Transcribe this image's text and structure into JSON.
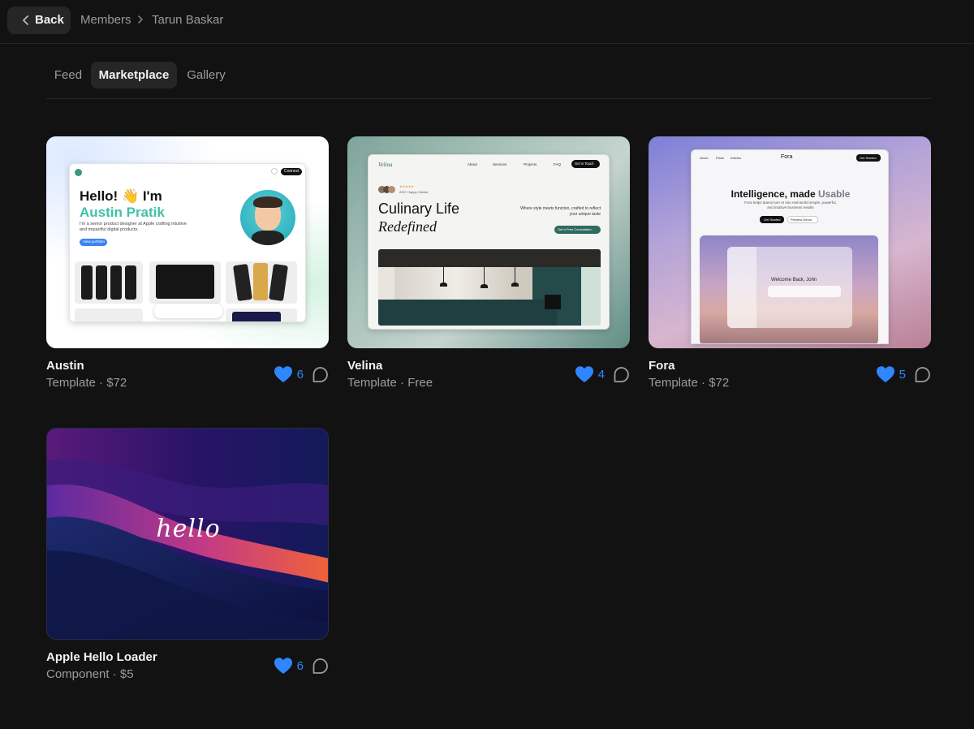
{
  "header": {
    "back_label": "Back",
    "breadcrumb": [
      "Members",
      "Tarun Baskar"
    ]
  },
  "tabs": [
    {
      "label": "Feed",
      "active": false
    },
    {
      "label": "Marketplace",
      "active": true
    },
    {
      "label": "Gallery",
      "active": false
    }
  ],
  "cards": [
    {
      "title": "Austin",
      "subtitle": "Template · $72",
      "likes": "6",
      "preview": {
        "connect": "Connect",
        "hero_line1": "Hello! 👋 I'm",
        "hero_name": "Austin Pratik",
        "bio": "I'm a senior product designer at Apple crafting intuitive and impactful digital products.",
        "cta": "View portfolio"
      }
    },
    {
      "title": "Velina",
      "subtitle": "Template · Free",
      "likes": "4",
      "preview": {
        "logo": "Velina",
        "nav": [
          "About",
          "Services",
          "Projects",
          "FAQ"
        ],
        "nav_cta": "Get in Touch",
        "clients": "200+ Happy Clients",
        "headline1": "Culinary Life",
        "headline2": "Redefined",
        "tagline": "Where style meets function, crafted to reflect your unique taste",
        "cta": "Get a Free Consultation"
      }
    },
    {
      "title": "Fora",
      "subtitle": "Template · $72",
      "likes": "5",
      "preview": {
        "logo": "Fora",
        "nav": [
          "About",
          "Plans",
          "Articles"
        ],
        "nav_cta": "Get Started",
        "headline": "Intelligence, made",
        "headline_accent": "Usable",
        "sub": "Fora helps teams turn AI into real-world simple, powerful, and intuitive business results",
        "btn1": "Get Started",
        "btn2": "Preview Demo",
        "welcome": "Welcome Back, John"
      }
    },
    {
      "title": "Apple Hello Loader",
      "subtitle": "Component · $5",
      "likes": "6",
      "preview": {
        "script": "hello"
      }
    }
  ],
  "colors": {
    "background": "#121212",
    "like_blue": "#2f86ff",
    "tab_active_bg": "#262626",
    "muted_text": "#9c9c9c"
  },
  "icons": [
    "chevron-left-icon",
    "chevron-right-icon",
    "heart-icon",
    "comment-icon"
  ]
}
